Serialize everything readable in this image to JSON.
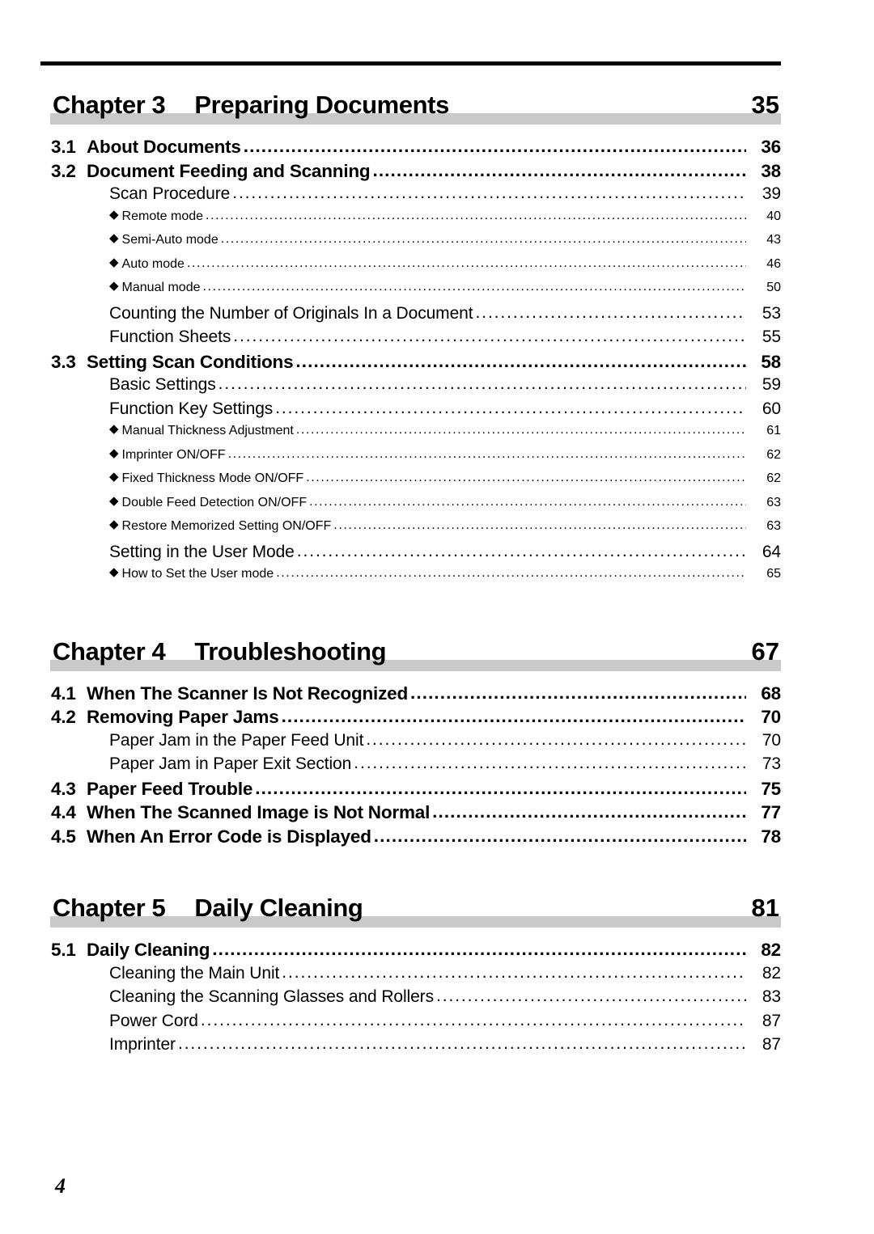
{
  "page": {
    "folio": "4",
    "rule_color": "#000000",
    "chapter_bar_color": "#c9c9c9"
  },
  "chapters": [
    {
      "chapter_label": "Chapter 3",
      "chapter_title": "Preparing Documents",
      "chapter_page": "35",
      "entries": [
        {
          "level": "section",
          "num": "3.1",
          "label": "About Documents",
          "page": "36"
        },
        {
          "level": "section",
          "num": "3.2",
          "label": "Document Feeding and Scanning",
          "page": "38"
        },
        {
          "level": "sub",
          "num": "",
          "label": "Scan Procedure",
          "page": "39"
        },
        {
          "level": "bullet",
          "num": "",
          "label": "Remote mode",
          "page": "40"
        },
        {
          "level": "bullet",
          "num": "",
          "label": "Semi-Auto mode",
          "page": "43"
        },
        {
          "level": "bullet",
          "num": "",
          "label": "Auto mode",
          "page": "46"
        },
        {
          "level": "bullet",
          "num": "",
          "label": "Manual mode",
          "page": "50"
        },
        {
          "level": "sub",
          "num": "",
          "label": "Counting the Number of Originals In a Document",
          "page": "53"
        },
        {
          "level": "sub",
          "num": "",
          "label": "Function Sheets",
          "page": "55"
        },
        {
          "level": "section",
          "num": "3.3",
          "label": "Setting Scan Conditions",
          "page": "58"
        },
        {
          "level": "sub",
          "num": "",
          "label": "Basic Settings",
          "page": "59"
        },
        {
          "level": "sub",
          "num": "",
          "label": "Function Key Settings",
          "page": "60"
        },
        {
          "level": "bullet",
          "num": "",
          "label": "Manual Thickness Adjustment",
          "page": "61"
        },
        {
          "level": "bullet",
          "num": "",
          "label": "Imprinter ON/OFF",
          "page": "62"
        },
        {
          "level": "bullet",
          "num": "",
          "label": "Fixed Thickness Mode ON/OFF",
          "page": "62"
        },
        {
          "level": "bullet",
          "num": "",
          "label": "Double Feed Detection ON/OFF",
          "page": "63"
        },
        {
          "level": "bullet",
          "num": "",
          "label": "Restore Memorized Setting ON/OFF",
          "page": "63"
        },
        {
          "level": "sub",
          "num": "",
          "label": "Setting in the User Mode",
          "page": "64"
        },
        {
          "level": "bullet",
          "num": "",
          "label": "How to Set the User mode",
          "page": "65"
        }
      ]
    },
    {
      "chapter_label": "Chapter 4",
      "chapter_title": "Troubleshooting",
      "chapter_page": "67",
      "entries": [
        {
          "level": "section",
          "num": "4.1",
          "label": "When The Scanner Is Not Recognized",
          "page": "68"
        },
        {
          "level": "section",
          "num": "4.2",
          "label": "Removing Paper Jams",
          "page": "70"
        },
        {
          "level": "sub",
          "num": "",
          "label": "Paper Jam in the Paper Feed Unit",
          "page": "70"
        },
        {
          "level": "sub",
          "num": "",
          "label": "Paper Jam in Paper Exit Section",
          "page": "73"
        },
        {
          "level": "section",
          "num": "4.3",
          "label": "Paper Feed Trouble",
          "page": "75"
        },
        {
          "level": "section",
          "num": "4.4",
          "label": "When The Scanned Image is Not Normal",
          "page": "77"
        },
        {
          "level": "section",
          "num": "4.5",
          "label": "When An Error Code is Displayed",
          "page": "78"
        }
      ]
    },
    {
      "chapter_label": "Chapter 5",
      "chapter_title": "Daily Cleaning",
      "chapter_page": "81",
      "entries": [
        {
          "level": "section",
          "num": "5.1",
          "label": "Daily Cleaning",
          "page": "82"
        },
        {
          "level": "sub",
          "num": "",
          "label": "Cleaning the Main Unit",
          "page": "82"
        },
        {
          "level": "sub",
          "num": "",
          "label": "Cleaning the Scanning Glasses and Rollers",
          "page": "83"
        },
        {
          "level": "sub",
          "num": "",
          "label": "Power Cord",
          "page": "87"
        },
        {
          "level": "sub",
          "num": "",
          "label": "Imprinter",
          "page": "87"
        }
      ]
    }
  ],
  "icons": {
    "bullet_glyph": "◆"
  }
}
